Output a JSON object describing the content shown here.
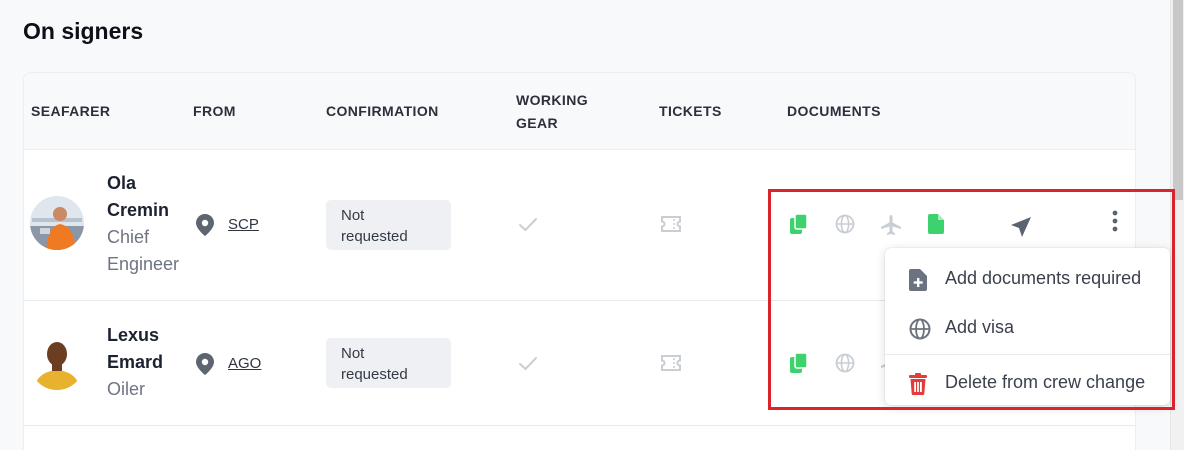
{
  "page": {
    "title": "On signers"
  },
  "table": {
    "headers": {
      "seafarer": "SEAFARER",
      "from": "FROM",
      "confirmation": "CONFIRMATION",
      "working_gear_1": "WORKING",
      "working_gear_2": "GEAR",
      "tickets": "TICKETS",
      "documents": "DOCUMENTS"
    },
    "rows": [
      {
        "first_name": "Ola",
        "last_name": "Cremin",
        "rank_1": "Chief",
        "rank_2": "Engineer",
        "from": "SCP",
        "confirmation_1": "Not",
        "confirmation_2": "requested"
      },
      {
        "first_name": "Lexus",
        "last_name": "Emard",
        "rank_1": "Oiler",
        "from": "AGO",
        "confirmation_1": "Not",
        "confirmation_2": "requested"
      }
    ]
  },
  "context_menu": {
    "items": [
      {
        "label": "Add documents required",
        "icon": "file-plus-icon"
      },
      {
        "label": "Add visa",
        "icon": "globe-icon"
      },
      {
        "label": "Delete from crew change",
        "icon": "trash-icon"
      }
    ]
  },
  "colors": {
    "doc_green": "#3ed26f",
    "muted_icon": "#c9cdd4",
    "delete_red": "#e53b3b",
    "highlight_red": "#d9242b"
  }
}
